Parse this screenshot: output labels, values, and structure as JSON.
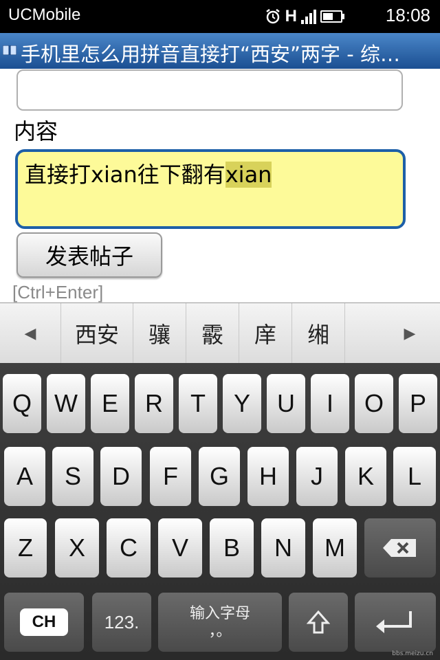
{
  "status_bar": {
    "app_name": "UCMobile",
    "time": "18:08",
    "network": "H"
  },
  "title_bar": {
    "title": "手机里怎么用拼音直接打“西安”两字 - 综…"
  },
  "form": {
    "content_label": "内容",
    "content_text": "直接打xian往下翻有",
    "content_highlight": "xian",
    "submit_label": "发表帖子",
    "shortcut_hint": "[Ctrl+Enter]"
  },
  "candidates": [
    "西安",
    "骧",
    "霰",
    "庠",
    "缃"
  ],
  "keyboard": {
    "row1": [
      "Q",
      "W",
      "E",
      "R",
      "T",
      "Y",
      "U",
      "I",
      "O",
      "P"
    ],
    "row2": [
      "A",
      "S",
      "D",
      "F",
      "G",
      "H",
      "J",
      "K",
      "L"
    ],
    "row3": [
      "Z",
      "X",
      "C",
      "V",
      "B",
      "N",
      "M"
    ],
    "lang_label": "CH",
    "num_label": "123.",
    "space_label": "输入字母",
    "space_sub": "，。"
  },
  "watermark": "bbs.meizu.cn"
}
